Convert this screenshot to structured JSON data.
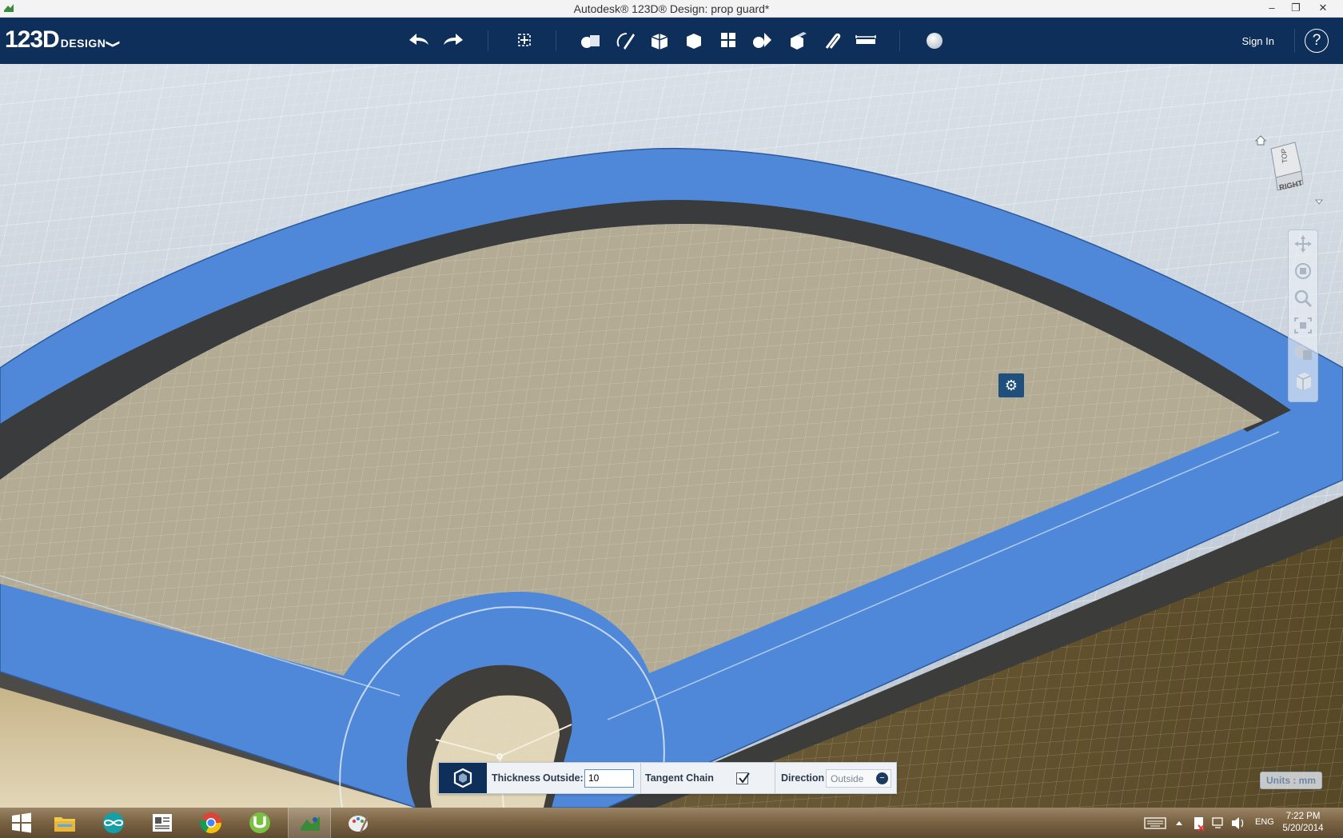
{
  "window": {
    "title": "Autodesk® 123D® Design: prop guard*",
    "minimize": "–",
    "restore": "❐",
    "close": "✕"
  },
  "app": {
    "logo_number": "123D",
    "logo_word": "DESIGN",
    "logo_menu": "❯"
  },
  "toolbar": {
    "tools": [
      "undo-icon",
      "redo-icon",
      "transform-icon",
      "primitives-icon",
      "sketch-icon",
      "construct-icon",
      "modify-icon",
      "pattern-icon",
      "grouping-icon",
      "combine-icon",
      "snap-icon",
      "measure-icon",
      "material-icon"
    ],
    "signin": "Sign In",
    "help": "?"
  },
  "viewcube": {
    "top": "TOP",
    "right": "RIGHT"
  },
  "navbar": {
    "tools": [
      "pan-icon",
      "orbit-icon",
      "zoom-icon",
      "fit-icon",
      "visual-style-icon",
      "material-view-icon"
    ]
  },
  "shell_panel": {
    "thickness_label": "Thickness",
    "outside_label": "Outside:",
    "outside_value": "10",
    "tangent_chain_label": "Tangent Chain",
    "tangent_chain_checked": true,
    "direction_label": "Direction",
    "direction_value": "Outside"
  },
  "status": {
    "units": "Units : mm"
  },
  "taskbar": {
    "apps": [
      "windows-start-icon",
      "file-explorer-icon",
      "arduino-icon",
      "news-reader-icon",
      "chrome-icon",
      "utorrent-icon",
      "123d-design-icon",
      "paint-icon"
    ],
    "language": "ENG",
    "time": "7:22 PM",
    "date": "5/20/2014"
  },
  "colors": {
    "toolbar_bg": "#0e2f5a",
    "part_blue": "#4f88d8",
    "plate_tan": "#b3ab93",
    "grid_bg": "#c9d2dc"
  }
}
